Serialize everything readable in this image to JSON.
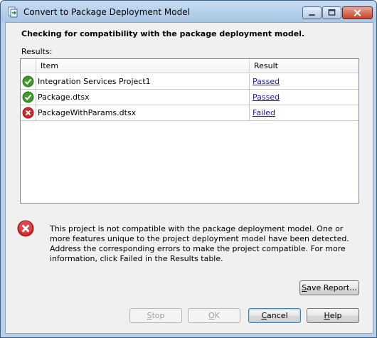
{
  "window": {
    "title": "Convert to Package Deployment Model"
  },
  "heading": "Checking for compatibility with the package deployment model.",
  "results_label": "Results:",
  "grid": {
    "columns": {
      "item": "Item",
      "result": "Result"
    },
    "rows": [
      {
        "status": "success",
        "item": "Integration Services Project1",
        "result": "Passed"
      },
      {
        "status": "success",
        "item": "Package.dtsx",
        "result": "Passed"
      },
      {
        "status": "error",
        "item": "PackageWithParams.dtsx",
        "result": "Failed"
      }
    ]
  },
  "message": "This project is not compatible with the package deployment model. One or more features unique to the project deployment model have been detected. Address the corresponding errors to make the project compatible. For more information, click Failed in the Results table.",
  "buttons": {
    "save_report": {
      "mnemonic": "S",
      "rest": "ave Report..."
    },
    "stop": {
      "mnemonic": "S",
      "rest": "top",
      "enabled": false
    },
    "ok": {
      "mnemonic": "O",
      "rest": "K",
      "enabled": false
    },
    "cancel": {
      "mnemonic": "C",
      "rest": "ancel",
      "enabled": true
    },
    "help": {
      "mnemonic": "H",
      "rest": "elp",
      "enabled": true
    }
  },
  "colors": {
    "success": "#3f9a2c",
    "error": "#d6262a",
    "link": "#1a1aa6"
  },
  "icons": {
    "app": "convert-package-icon",
    "success": "check-circle-icon",
    "error": "error-x-circle-icon"
  }
}
